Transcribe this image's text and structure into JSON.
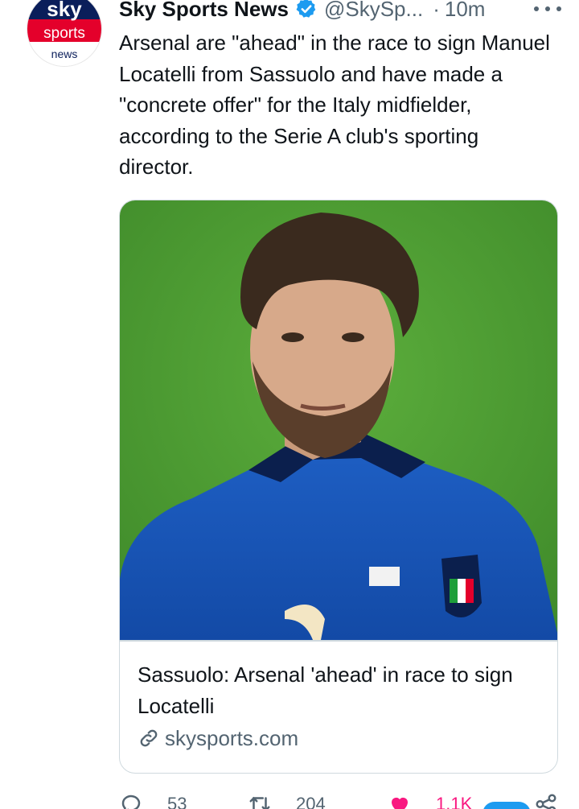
{
  "account": {
    "display_name": "Sky Sports News",
    "handle": "@SkySp...",
    "separator": "·",
    "time": "10m",
    "avatar_logo": {
      "line1": "sky",
      "line2": "sports",
      "line3": "news"
    },
    "verified": true
  },
  "tweet": {
    "text": "Arsenal are \"ahead\" in the race to sign Manuel Locatelli from Sassuolo and have made a \"concrete offer\" for the Italy midfielder, according to the Serie A club's sporting director."
  },
  "card": {
    "title": "Sassuolo: Arsenal 'ahead' in race to sign Locatelli",
    "domain": "skysports.com",
    "image_icon": "player-photo"
  },
  "actions": {
    "replies": "53",
    "retweets": "204",
    "likes": "1.1K"
  },
  "colors": {
    "text_primary": "#0f1419",
    "text_secondary": "#536471",
    "border": "#cfd9de",
    "verified_blue": "#1d9bf0",
    "like_pink": "#f91880",
    "sky_red": "#e4002b",
    "sky_navy": "#0a1e5a"
  },
  "icons": {
    "verified": "verified-badge-icon",
    "more": "more-options-icon",
    "link": "link-icon",
    "reply": "reply-icon",
    "retweet": "retweet-icon",
    "like": "heart-icon",
    "share": "share-icon"
  }
}
